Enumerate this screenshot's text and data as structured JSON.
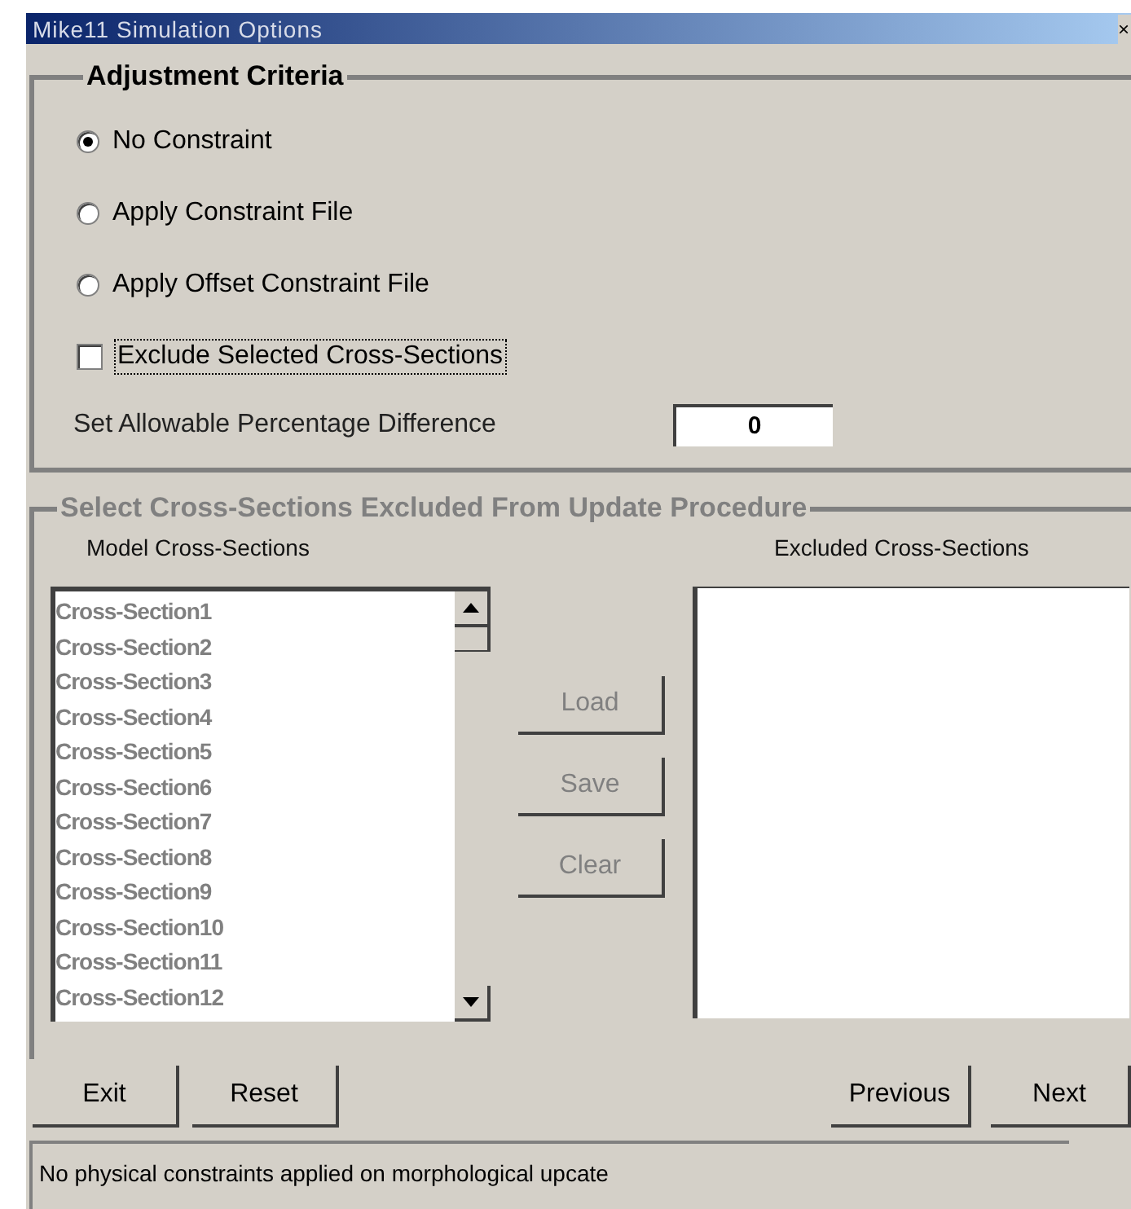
{
  "window": {
    "title": "Mike11 Simulation Options",
    "close": "×"
  },
  "adjustment_criteria": {
    "title": "Adjustment Criteria",
    "options": [
      {
        "label": "No Constraint",
        "selected": true
      },
      {
        "label": "Apply Constraint File",
        "selected": false
      },
      {
        "label": "Apply Offset Constraint File",
        "selected": false
      }
    ],
    "exclude_checkbox": {
      "label": "Exclude Selected Cross-Sections",
      "checked": false
    },
    "percentage": {
      "label": "Set Allowable Percentage Difference",
      "value": "0"
    }
  },
  "exclusion": {
    "title": "Select Cross-Sections Excluded From Update Procedure",
    "disabled": true,
    "model_label": "Model Cross-Sections",
    "excluded_label": "Excluded Cross-Sections",
    "model_items": [
      {
        "label": "Cross-Section1"
      },
      {
        "label": "Cross-Section2"
      },
      {
        "label": "Cross-Section3"
      },
      {
        "label": "Cross-Section4"
      },
      {
        "label": "Cross-Section5"
      },
      {
        "label": "Cross-Section6"
      },
      {
        "label": "Cross-Section7"
      },
      {
        "label": "Cross-Section8"
      },
      {
        "label": "Cross-Section9"
      },
      {
        "label": "Cross-Section10"
      },
      {
        "label": "Cross-Section11"
      },
      {
        "label": "Cross-Section12"
      }
    ],
    "buttons": [
      {
        "label": "Load",
        "disabled": true
      },
      {
        "label": "Save",
        "disabled": true
      },
      {
        "label": "Clear",
        "disabled": true
      }
    ]
  },
  "nav_buttons_left": [
    "Exit",
    "Reset"
  ],
  "nav_buttons_right": [
    "Previous",
    "Next"
  ],
  "status_bar": "No physical constraints applied on morphological upcate"
}
